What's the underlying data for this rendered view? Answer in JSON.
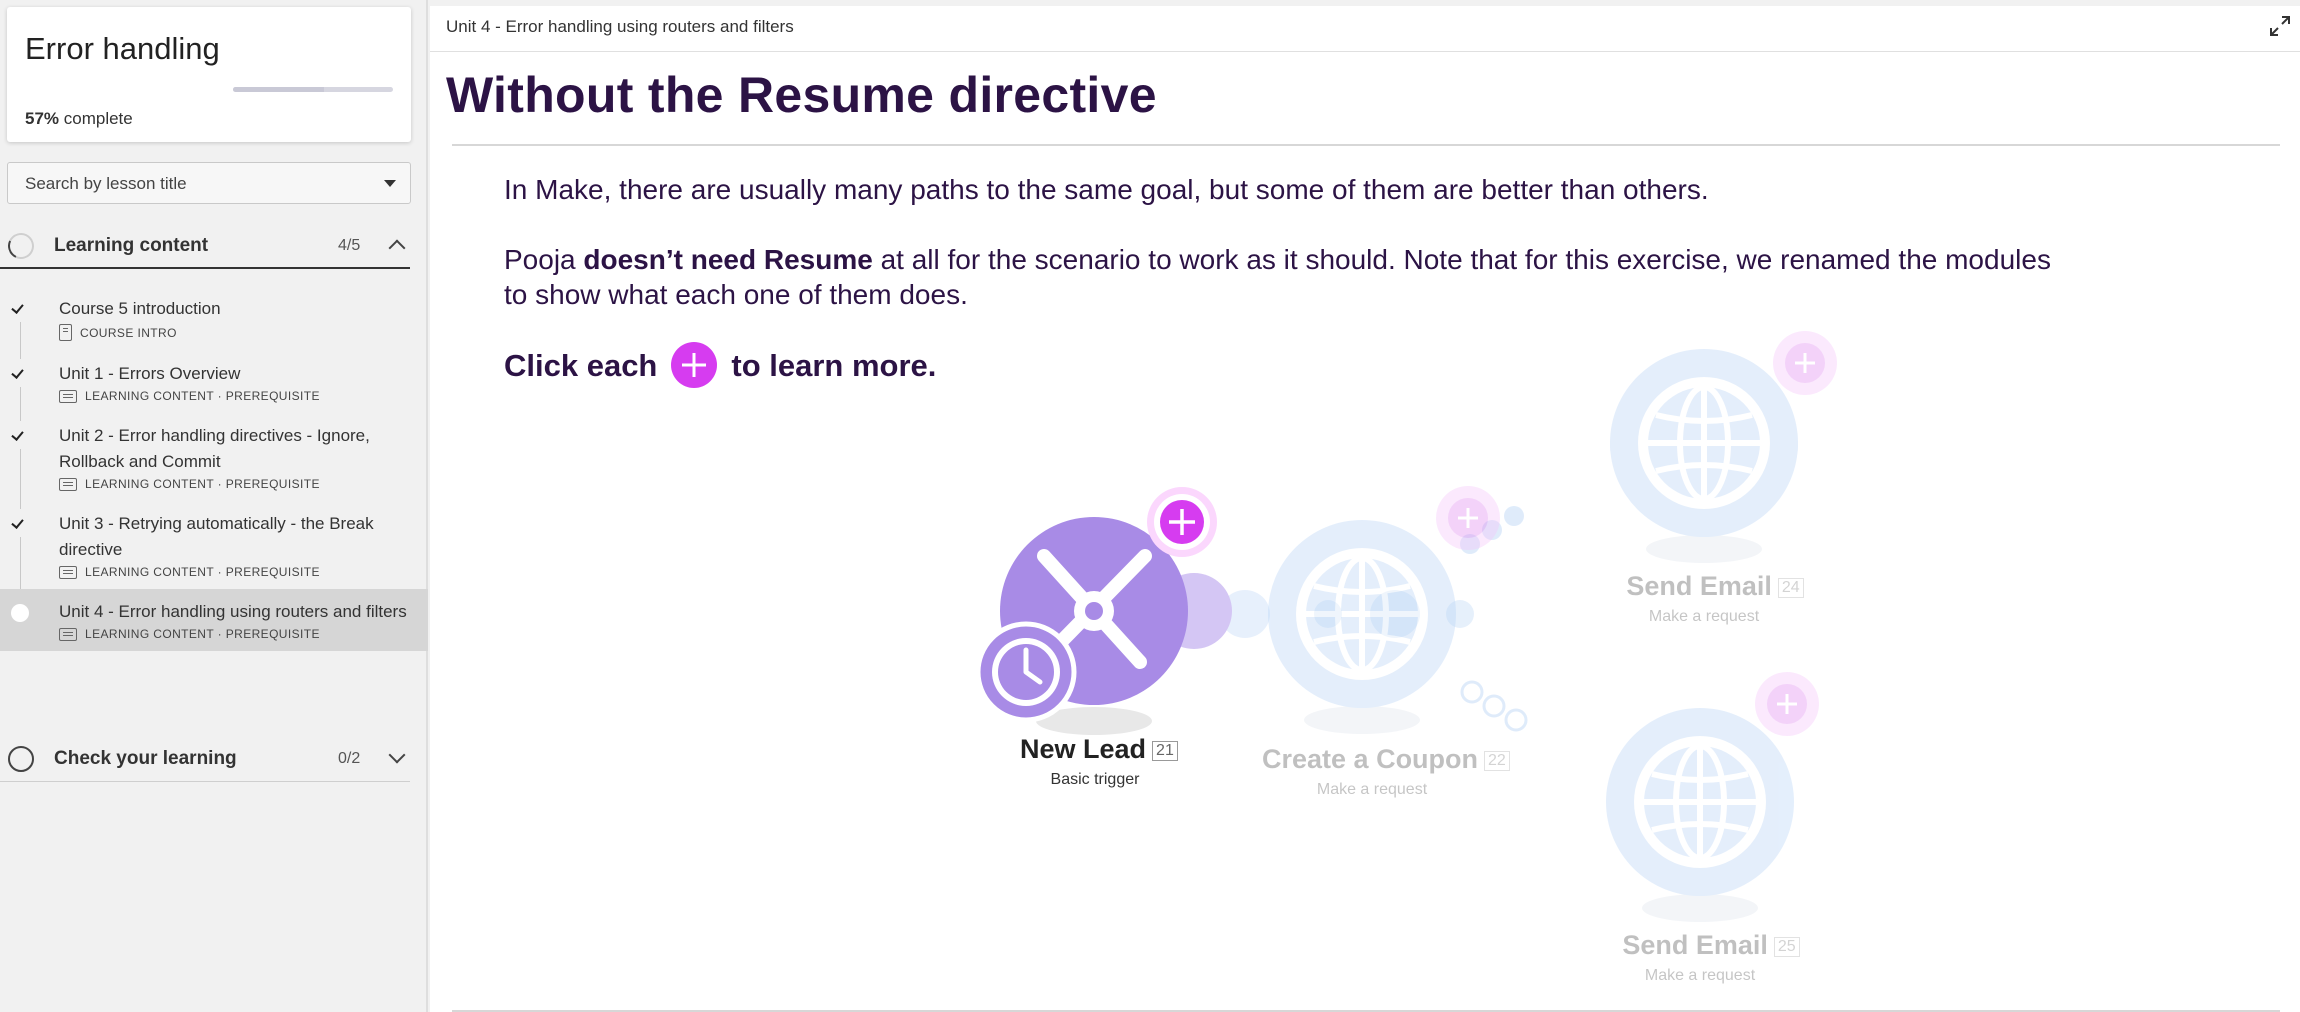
{
  "sidebar": {
    "course_title": "Error handling",
    "progress_percent": "57%",
    "progress_suffix": " complete",
    "progress_fraction": 0.57,
    "search_placeholder": "Search by lesson title",
    "sections": [
      {
        "label": "Learning content",
        "count": "4/5",
        "expanded": true
      },
      {
        "label": "Check your learning",
        "count": "0/2",
        "expanded": false
      }
    ],
    "lessons": [
      {
        "title": "Course 5 introduction",
        "meta": "COURSE INTRO",
        "done": true,
        "active": false,
        "icon": "document-icon"
      },
      {
        "title": "Unit 1 - Errors Overview",
        "meta": "LEARNING CONTENT · PREREQUISITE",
        "done": true,
        "active": false,
        "icon": "slides-icon"
      },
      {
        "title": "Unit 2 - Error handling directives - Ignore, Rollback and Commit",
        "meta": "LEARNING CONTENT · PREREQUISITE",
        "done": true,
        "active": false,
        "icon": "slides-icon"
      },
      {
        "title": "Unit 3 - Retrying automatically - the Break directive",
        "meta": "LEARNING CONTENT · PREREQUISITE",
        "done": true,
        "active": false,
        "icon": "slides-icon"
      },
      {
        "title": "Unit 4 - Error handling using routers and filters",
        "meta": "LEARNING CONTENT · PREREQUISITE",
        "done": false,
        "active": true,
        "icon": "slides-icon"
      }
    ]
  },
  "main": {
    "breadcrumb": "Unit 4 - Error handling using routers and filters",
    "title": "Without the Resume directive",
    "para1": "In Make, there are usually many paths to the same goal, but some of them are better than others.",
    "para2_pre": "Pooja ",
    "para2_bold": "doesn’t need Resume",
    "para2_post": " at all for the scenario to work as it should. Note that for this exercise, we renamed the modules to show what each one of them does.",
    "para3_pre": "Click each",
    "para3_post": "to learn more."
  },
  "diagram": {
    "modules": [
      {
        "name": "New Lead",
        "num": "21",
        "sub": "Basic trigger",
        "faded": false
      },
      {
        "name": "Create a Coupon",
        "num": "22",
        "sub": "Make a request",
        "faded": true
      },
      {
        "name": "Send Email",
        "num": "24",
        "sub": "Make a request",
        "faded": true
      },
      {
        "name": "Send Email",
        "num": "25",
        "sub": "Make a request",
        "faded": true
      }
    ]
  },
  "colors": {
    "title": "#2c1345",
    "accent_plus": "#d63cf0",
    "trigger_purple": "#a88be6",
    "http_blue": "#b9d5f6"
  }
}
